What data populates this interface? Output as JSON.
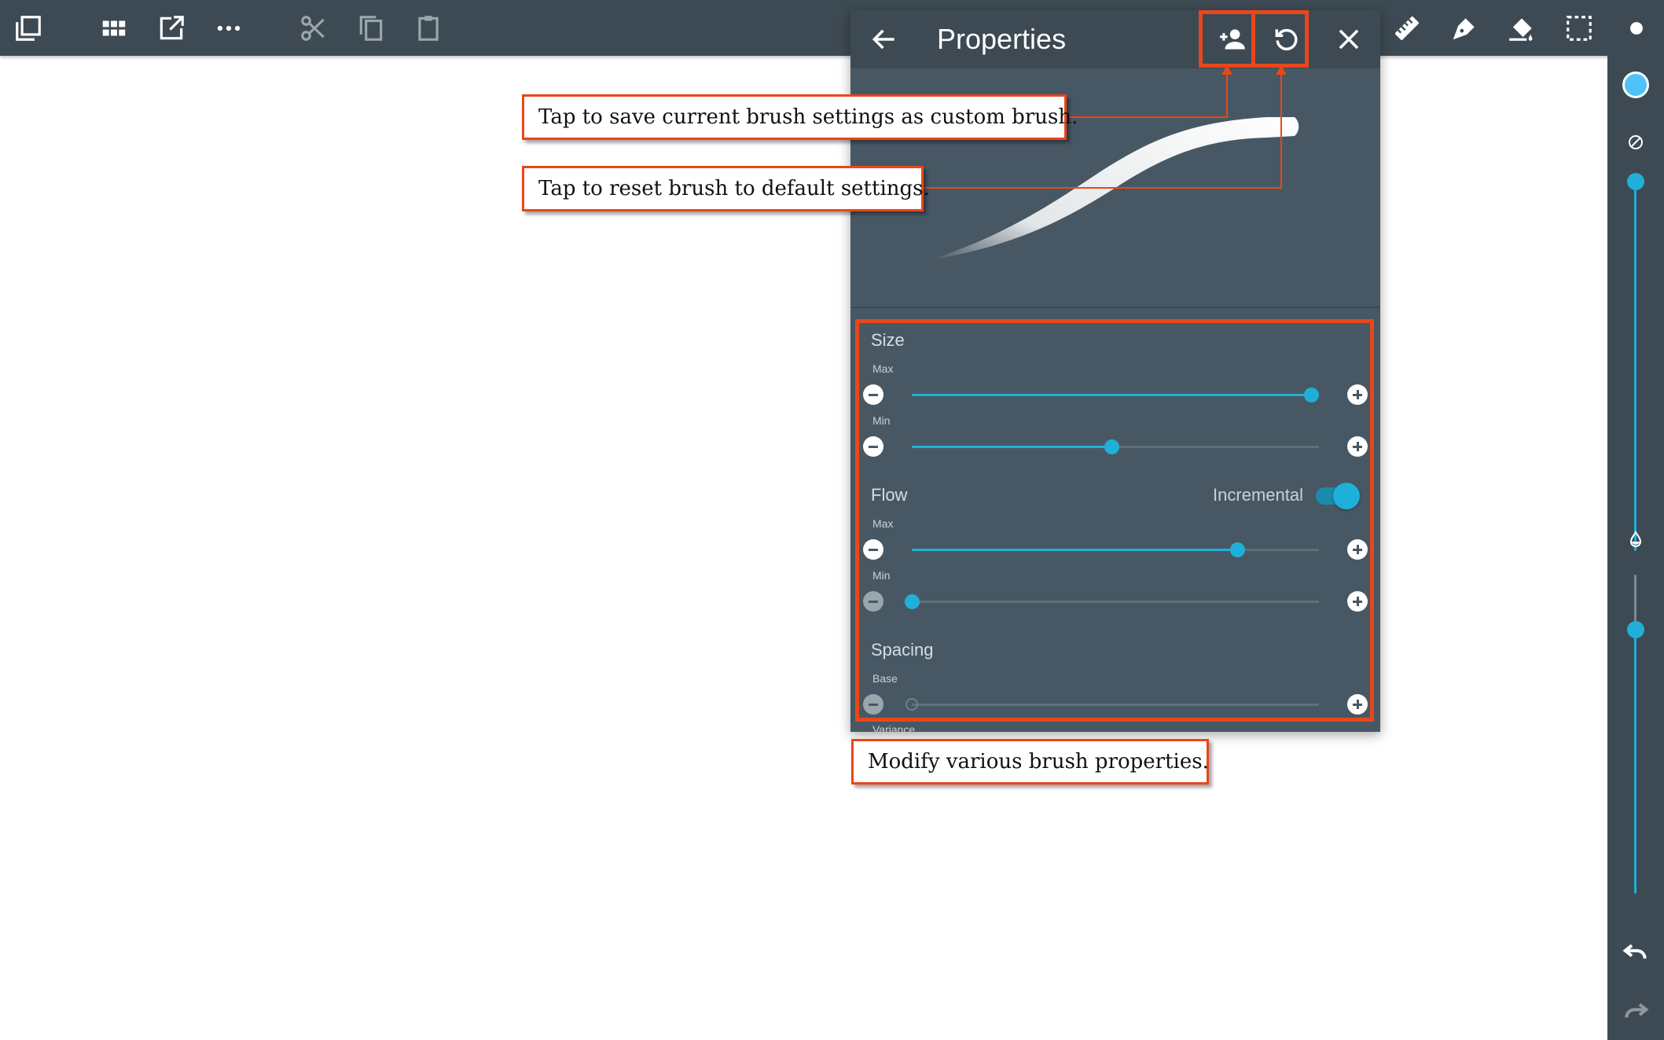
{
  "toolbar": {
    "left_icons": [
      "layers-icon",
      "grid-icon",
      "share-icon",
      "more-icon",
      "cut-icon",
      "copy-icon",
      "paste-icon"
    ],
    "right_icons": [
      "ruler-icon",
      "pen-icon",
      "fill-bucket-icon",
      "selection-icon"
    ]
  },
  "panel": {
    "title": "Properties",
    "back_icon": "arrow-back-icon",
    "save_custom_icon": "person-add-icon",
    "reset_icon": "reset-icon",
    "close_icon": "close-icon",
    "sections": {
      "size": {
        "label": "Size",
        "max": {
          "label": "Max",
          "value": 0.98
        },
        "min": {
          "label": "Min",
          "value": 0.49
        }
      },
      "flow": {
        "label": "Flow",
        "incremental_label": "Incremental",
        "incremental_on": true,
        "max": {
          "label": "Max",
          "value": 0.8
        },
        "min": {
          "label": "Min",
          "value": 0.0
        }
      },
      "spacing": {
        "label": "Spacing",
        "base": {
          "label": "Base",
          "value": 0.0
        },
        "variance_label": "Variance"
      }
    }
  },
  "callouts": {
    "save_custom": "Tap to save current brush settings as custom brush.",
    "reset": "Tap to reset brush to default settings.",
    "modify": "Modify various brush properties."
  },
  "sidebar": {
    "color": "#4fc3f7",
    "size_level": 1.0,
    "opacity_level": 0.85
  },
  "colors": {
    "accent": "#1fb0d9",
    "callout_border": "#e8471b",
    "toolbar": "#3d4a53",
    "panel": "#475864"
  }
}
